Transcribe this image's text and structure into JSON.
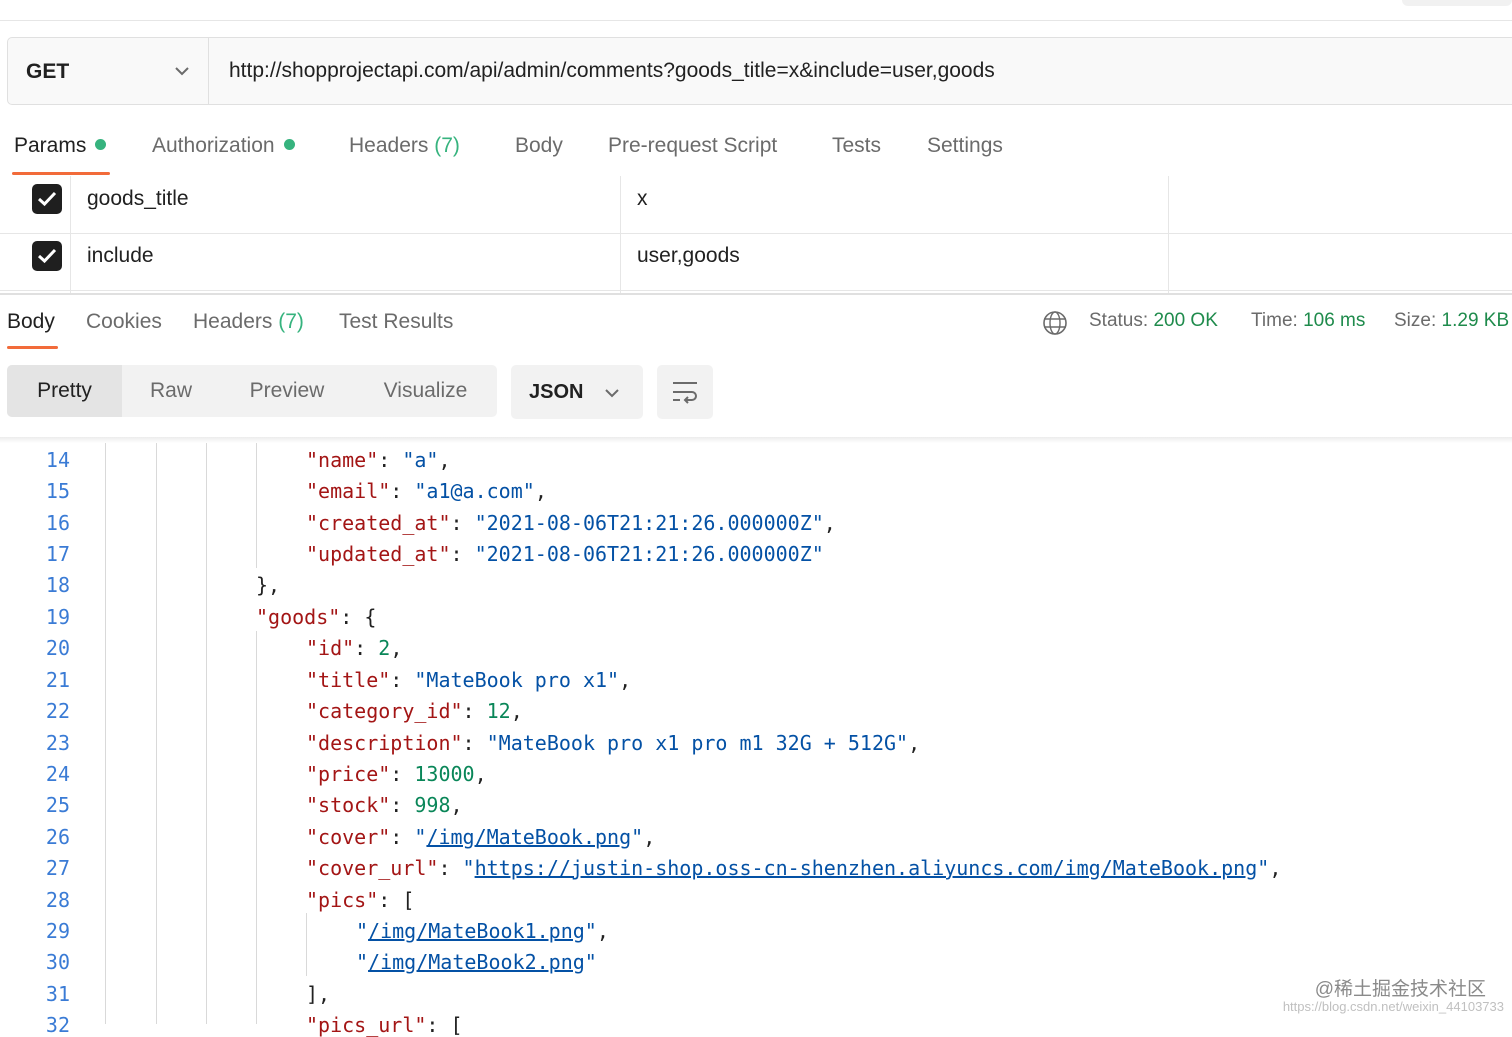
{
  "request": {
    "method": "GET",
    "url": "http://shopprojectapi.com/api/admin/comments?goods_title=x&include=user,goods"
  },
  "request_tabs": [
    {
      "label": "Params"
    },
    {
      "label": "Authorization"
    },
    {
      "label": "Headers",
      "count": "(7)"
    },
    {
      "label": "Body"
    },
    {
      "label": "Pre-request Script"
    },
    {
      "label": "Tests"
    },
    {
      "label": "Settings"
    }
  ],
  "params": [
    {
      "key": "goods_title",
      "value": "x",
      "checked": true
    },
    {
      "key": "include",
      "value": "user,goods",
      "checked": true
    }
  ],
  "response_tabs": [
    {
      "label": "Body"
    },
    {
      "label": "Cookies"
    },
    {
      "label": "Headers",
      "count": "(7)"
    },
    {
      "label": "Test Results"
    }
  ],
  "status": {
    "status_label": "Status:",
    "status_value": "200 OK",
    "time_label": "Time:",
    "time_value": "106 ms",
    "size_label": "Size:",
    "size_value": "1.29 KB"
  },
  "format": {
    "modes": [
      "Pretty",
      "Raw",
      "Preview",
      "Visualize"
    ],
    "language": "JSON"
  },
  "code_lines": [
    {
      "n": "14",
      "text": "\"name\": \"a\","
    },
    {
      "n": "15",
      "text": "\"email\": \"a1@a.com\","
    },
    {
      "n": "16",
      "text": "\"created_at\": \"2021-08-06T21:21:26.000000Z\","
    },
    {
      "n": "17",
      "text": "\"updated_at\": \"2021-08-06T21:21:26.000000Z\""
    },
    {
      "n": "18",
      "text": "},"
    },
    {
      "n": "19",
      "text": "\"goods\": {"
    },
    {
      "n": "20",
      "text": "\"id\": 2,"
    },
    {
      "n": "21",
      "text": "\"title\": \"MateBook pro x1\","
    },
    {
      "n": "22",
      "text": "\"category_id\": 12,"
    },
    {
      "n": "23",
      "text": "\"description\": \"MateBook pro x1 pro m1 32G + 512G\","
    },
    {
      "n": "24",
      "text": "\"price\": 13000,"
    },
    {
      "n": "25",
      "text": "\"stock\": 998,"
    },
    {
      "n": "26",
      "text": "\"cover\": \"/img/MateBook.png\","
    },
    {
      "n": "27",
      "text": "\"cover_url\": \"https://justin-shop.oss-cn-shenzhen.aliyuncs.com/img/MateBook.png\","
    },
    {
      "n": "28",
      "text": "\"pics\": ["
    },
    {
      "n": "29",
      "text": "\"/img/MateBook1.png\","
    },
    {
      "n": "30",
      "text": "\"/img/MateBook2.png\""
    },
    {
      "n": "31",
      "text": "],"
    },
    {
      "n": "32",
      "text": "\"pics_url\": ["
    }
  ],
  "watermark": {
    "main": "@稀土掘金技术社区",
    "sub": "https://blog.csdn.net/weixin_44103733"
  },
  "colors": {
    "accent": "#f26b3a",
    "success": "#36b37e",
    "json_key": "#a31515",
    "json_string": "#0451a5",
    "json_number": "#098658"
  }
}
